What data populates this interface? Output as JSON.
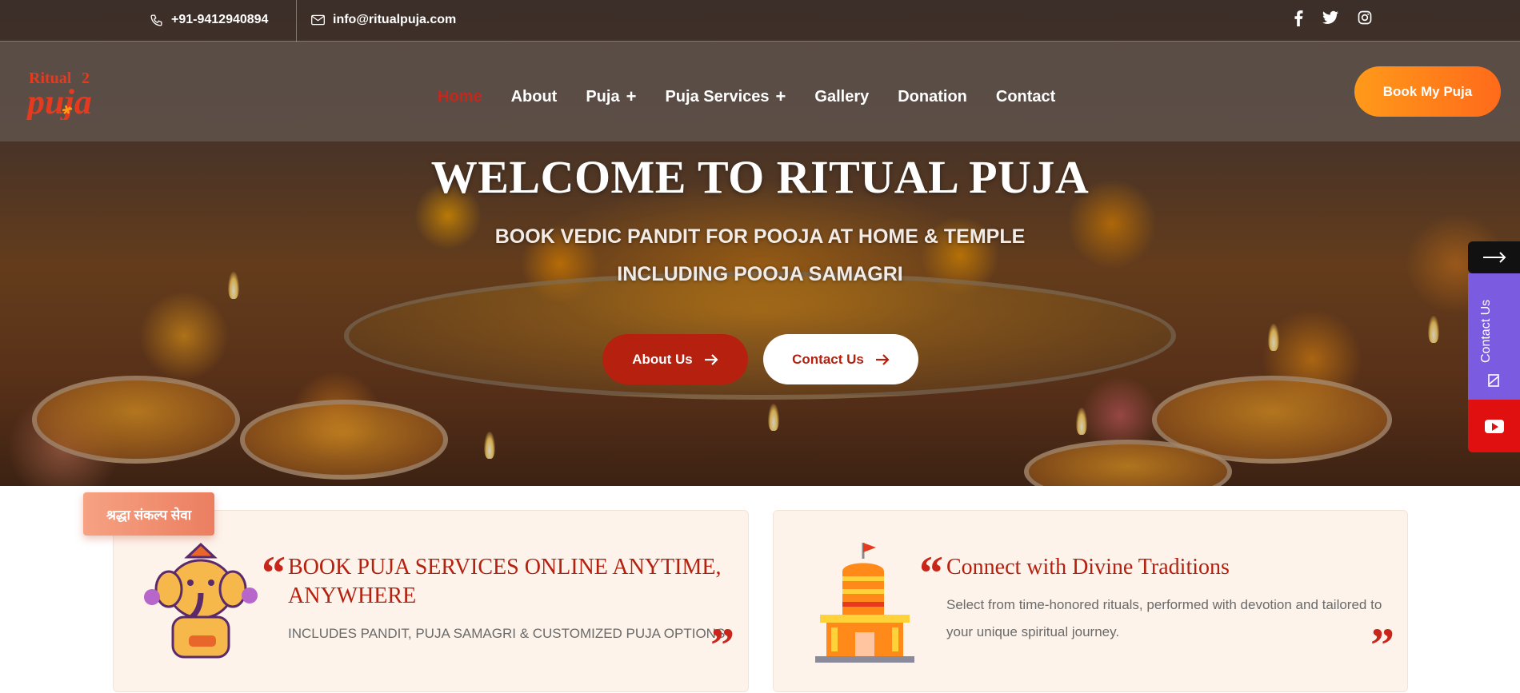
{
  "topbar": {
    "phone": "+91-9412940894",
    "email": "info@ritualpuja.com",
    "social_icons": [
      "facebook-icon",
      "twitter-icon",
      "instagram-icon"
    ]
  },
  "nav": {
    "logo_alt": "Ritual Puja",
    "items": [
      {
        "label": "Home",
        "active": true,
        "expandable": false
      },
      {
        "label": "About",
        "active": false,
        "expandable": false
      },
      {
        "label": "Puja",
        "active": false,
        "expandable": true
      },
      {
        "label": "Puja Services",
        "active": false,
        "expandable": true
      },
      {
        "label": "Gallery",
        "active": false,
        "expandable": false
      },
      {
        "label": "Donation",
        "active": false,
        "expandable": false
      },
      {
        "label": "Contact",
        "active": false,
        "expandable": false
      }
    ],
    "cta": "Book My Puja"
  },
  "hero": {
    "title": "WELCOME TO RITUAL PUJA",
    "subtitle_line1": "BOOK VEDIC PANDIT FOR POOJA AT HOME & TEMPLE",
    "subtitle_line2": "INCLUDING POOJA SAMAGRI",
    "btn_about": "About Us",
    "btn_contact": "Contact Us"
  },
  "side": {
    "contact_label": "Contact Us"
  },
  "badge": "श्रद्धा संकल्प सेवा",
  "cards": [
    {
      "title": "BOOK PUJA SERVICES ONLINE ANYTIME, ANYWHERE",
      "text": "INCLUDES PANDIT, PUJA SAMAGRI & CUSTOMIZED PUJA OPTIONS"
    },
    {
      "title": "Connect with Divine Traditions",
      "text": "Select from time-honored rituals, performed with devotion and tailored to your unique spiritual journey."
    }
  ],
  "colors": {
    "brand_red": "#b5200f",
    "cta_orange": "#ff8a1a",
    "side_purple": "#7b5ce0",
    "youtube_red": "#e01010",
    "card_bg": "#fdf3ea"
  }
}
